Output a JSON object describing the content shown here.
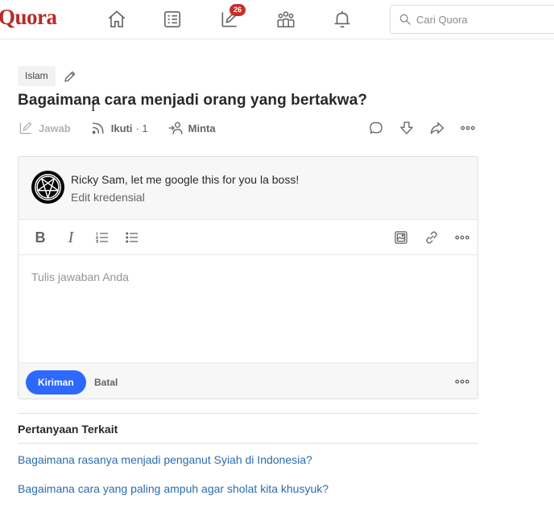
{
  "header": {
    "logo_text": "Quora",
    "nav": [
      {
        "name": "home-icon"
      },
      {
        "name": "following-list-icon"
      },
      {
        "name": "answer-pencil-icon",
        "badge": "26"
      },
      {
        "name": "spaces-people-icon"
      },
      {
        "name": "notifications-bell-icon"
      }
    ],
    "search_placeholder": "Cari Quora"
  },
  "question": {
    "topic": "Islam",
    "title": "Bagaimana cara menjadi orang yang bertakwa?",
    "actions": {
      "answer_label": "Jawab",
      "follow_label": "Ikuti",
      "follow_count": "· 1",
      "request_label": "Minta"
    }
  },
  "editor": {
    "user_line": "Ricky Sam, let me google this for you la boss!",
    "edit_credential": "Edit kredensial",
    "placeholder": "Tulis jawaban Anda",
    "toolbar": {
      "bold": "B",
      "italic": "I"
    },
    "submit_label": "Kiriman",
    "cancel_label": "Batal"
  },
  "related": {
    "title": "Pertanyaan Terkait",
    "links": [
      "Bagaimana rasanya menjadi penganut Syiah di Indonesia?",
      "Bagaimana cara yang paling ampuh agar sholat kita khusyuk?"
    ]
  },
  "colors": {
    "brand": "#b92b27",
    "accent": "#2e69ff",
    "link": "#2b6dad",
    "badge": "#c4302b"
  }
}
